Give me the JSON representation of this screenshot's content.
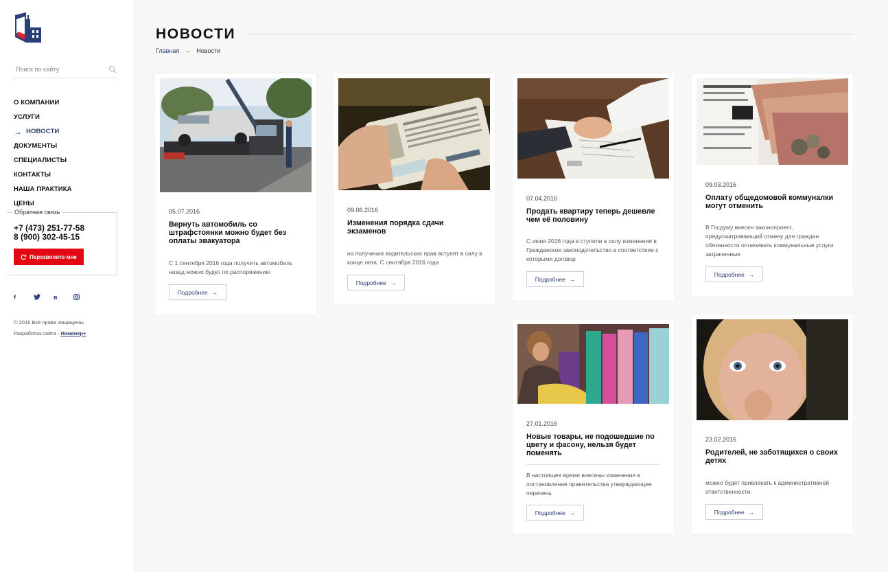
{
  "sidebar": {
    "search_placeholder": "Поиск по сайту",
    "nav": [
      {
        "label": "О компании",
        "active": false
      },
      {
        "label": "Услуги",
        "active": false
      },
      {
        "label": "Новости",
        "active": true
      },
      {
        "label": "Документы",
        "active": false
      },
      {
        "label": "Специалисты",
        "active": false
      },
      {
        "label": "Контакты",
        "active": false
      },
      {
        "label": "Наша практика",
        "active": false
      },
      {
        "label": "Цены",
        "active": false
      }
    ],
    "feedback": {
      "title": "Обратная связь",
      "phone1": "+7 (473) 251-77-58",
      "phone2": "8 (900) 302-45-15",
      "button": "Перезвоните мне"
    },
    "socials": [
      "f",
      "twitter",
      "в",
      "instagram"
    ],
    "copyright": "© 2016 Все права защищены.",
    "developer_prefix": "Разработка сайта - ",
    "developer_link": "Инженер+"
  },
  "page": {
    "title": "НОВОСТИ",
    "breadcrumb": {
      "home": "Главная",
      "separator": "→",
      "current": "Новости"
    }
  },
  "cards": [
    {
      "date": "05.07.2016",
      "title": "Вернуть автомобиль со штрафстоянки можно будет без оплаты эвакуатора",
      "excerpt": "С 1 сентября 2016 года получить автомобиль назад можно будет по распоряжению",
      "more": "Подробнее"
    },
    {
      "date": "09.06.2016",
      "title": "Изменения порядка сдачи экзаменов",
      "excerpt": "на получение водительских прав вступят в силу в конце лета. С сентября 2016 года",
      "more": "Подробнее"
    },
    {
      "date": "07.04.2016",
      "title": "Продать квартиру теперь дешевле чем её половину",
      "excerpt": "С июня 2016 года в ступили в силу изменения в Гражданское законодательство в соответствии с которыми договор",
      "more": "Подробнее"
    },
    {
      "date": "09.03.2016",
      "title": "Оплату общедомовой коммуналки могут отменить",
      "excerpt": "В Госдуму внесен законопроект, предусматривающий отмену для граждан обязанности оплачивать коммунальные услуги затраченные",
      "more": "Подробнее"
    },
    {
      "date": "27.01.2016",
      "title": "Новые товары, не подошедшие по цвету и фасону, нельзя будет поменять",
      "excerpt": "В настоящее время внесены изменения в постановление правительства утверждающее перечень",
      "more": "Подробнее"
    },
    {
      "date": "23.02.2016",
      "title": "Родителей, не заботящихся о своих детях",
      "excerpt": "можно будет привлекать к административной ответственности.",
      "more": "Подробнее"
    }
  ],
  "colors": {
    "accent": "#2b3f78",
    "callback": "#e30613",
    "background": "#f7f7f7"
  }
}
